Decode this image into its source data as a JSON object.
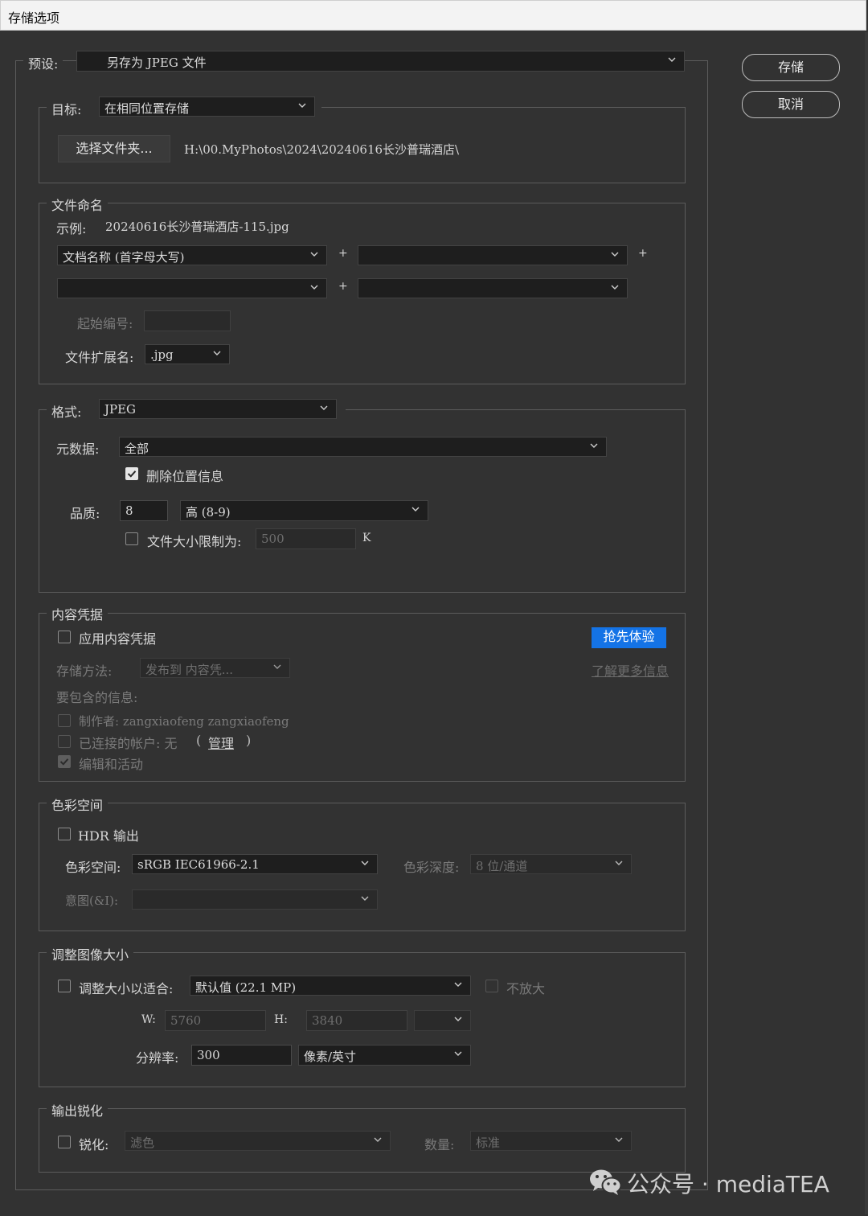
{
  "window": {
    "title": "存储选项"
  },
  "preset": {
    "label": "预设:",
    "value": "另存为 JPEG 文件"
  },
  "buttons": {
    "save": "存储",
    "cancel": "取消"
  },
  "target": {
    "label": "目标:",
    "value": "在相同位置存储",
    "choose_folder": "选择文件夹...",
    "path": "H:\\00.MyPhotos\\2024\\20240616长沙普瑞酒店\\"
  },
  "naming": {
    "legend": "文件命名",
    "example_label": "示例:",
    "example_value": "20240616长沙普瑞酒店-115.jpg",
    "field1": "文档名称 (首字母大写)",
    "field2": "",
    "field3": "",
    "field4": "",
    "plus": "+",
    "start_number_label": "起始编号:",
    "start_number_value": "",
    "extension_label": "文件扩展名:",
    "extension_value": ".jpg"
  },
  "format": {
    "label": "格式:",
    "value": "JPEG",
    "metadata_label": "元数据:",
    "metadata_value": "全部",
    "remove_location_label": "删除位置信息",
    "remove_location_checked": true,
    "quality_label": "品质:",
    "quality_value": "8",
    "quality_level": "高 (8-9)",
    "size_limit_label": "文件大小限制为:",
    "size_limit_checked": false,
    "size_limit_value": "500",
    "size_limit_unit": "K"
  },
  "content_credentials": {
    "legend": "内容凭据",
    "apply_label": "应用内容凭据",
    "apply_checked": false,
    "early_access": "抢先体验",
    "storage_label": "存储方法:",
    "storage_value": "发布到 内容凭...",
    "learn_more": "了解更多信息",
    "include_label": "要包含的信息:",
    "producer_label": "制作者: zangxiaofeng zangxiaofeng",
    "accounts_label": "已连接的帐户: 无",
    "accounts_open": "(",
    "accounts_manage": "管理",
    "accounts_close": ")",
    "edits_label": "编辑和活动",
    "edits_checked": true
  },
  "color_space": {
    "legend": "色彩空间",
    "hdr_label": "HDR 输出",
    "hdr_checked": false,
    "space_label": "色彩空间:",
    "space_value": "sRGB IEC61966-2.1",
    "depth_label": "色彩深度:",
    "depth_value": "8 位/通道",
    "intent_label": "意图(&I):",
    "intent_value": ""
  },
  "resize": {
    "legend": "调整图像大小",
    "fit_label": "调整大小以适合:",
    "fit_checked": false,
    "fit_value": "默认值 (22.1 MP)",
    "no_enlarge_label": "不放大",
    "no_enlarge_checked": false,
    "w_label": "W:",
    "w_value": "5760",
    "h_label": "H:",
    "h_value": "3840",
    "unit_value": "",
    "resolution_label": "分辨率:",
    "resolution_value": "300",
    "resolution_unit": "像素/英寸"
  },
  "sharpen": {
    "legend": "输出锐化",
    "sharpen_label": "锐化:",
    "sharpen_checked": false,
    "sharpen_value": "滤色",
    "amount_label": "数量:",
    "amount_value": "标准"
  },
  "watermark": {
    "text": "公众号 · mediaTEA"
  },
  "icons": {
    "chevron": "chevron-down-icon",
    "check": "checkmark-icon",
    "wechat": "wechat-icon"
  }
}
